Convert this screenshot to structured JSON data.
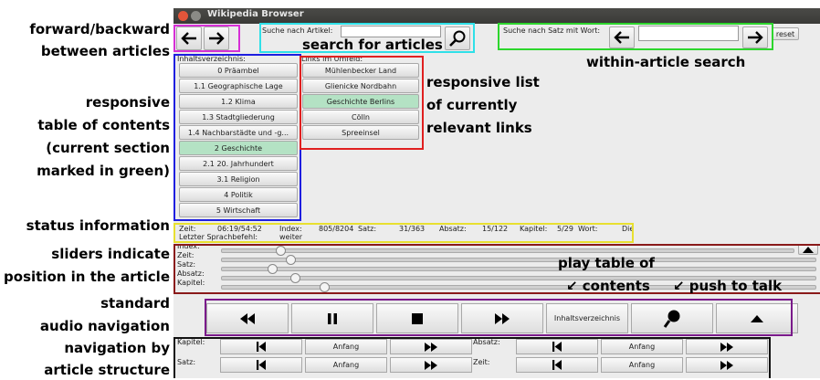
{
  "annotations": {
    "forward_backward": "forward/backward",
    "between_articles": "between articles",
    "search_for_articles": "search for articles",
    "within_article_search": "within-article search",
    "responsive_lines": [
      "responsive",
      "table of contents",
      "(current section",
      "marked in green)"
    ],
    "links_lines": [
      "responsive list",
      "of currently",
      "relevant links"
    ],
    "status_information": "status information",
    "sliders_lines": [
      "sliders indicate",
      "position in the article"
    ],
    "standard_lines": [
      "standard",
      "audio navigation"
    ],
    "structure_lines": [
      "navigation by",
      "article structure"
    ],
    "play_toc_lines": [
      "play table of",
      "↙ contents"
    ],
    "push_to_talk": "↙ push to talk"
  },
  "colors": {
    "pink": "#d62fd6",
    "cyan": "#2fe0e8",
    "green": "#2dd62d",
    "blue": "#1e1ee0",
    "red": "#e02020",
    "yellow": "#e8e030",
    "darkred": "#8a1a1a",
    "purple": "#7a1a8a",
    "black": "#111111",
    "selected_green": "#b4e2c4"
  },
  "window": {
    "title": "Wikipedia Browser"
  },
  "search": {
    "article_label": "Suche nach Artikel:",
    "article_value": "",
    "sentence_label": "Suche nach Satz mit Wort:",
    "sentence_value": "",
    "reset_label": "reset"
  },
  "toc": {
    "header": "Inhaltsverzeichnis:",
    "items": [
      {
        "label": "0 Präambel",
        "selected": false
      },
      {
        "label": "1.1 Geographische Lage",
        "selected": false
      },
      {
        "label": "1.2 Klima",
        "selected": false
      },
      {
        "label": "1.3 Stadtgliederung",
        "selected": false
      },
      {
        "label": "1.4 Nachbarstädte und -g...",
        "selected": false
      },
      {
        "label": "2 Geschichte",
        "selected": true
      },
      {
        "label": "2.1 20. Jahrhundert",
        "selected": false
      },
      {
        "label": "3.1 Religion",
        "selected": false
      },
      {
        "label": "4 Politik",
        "selected": false
      },
      {
        "label": "5 Wirtschaft",
        "selected": false
      }
    ]
  },
  "links": {
    "header": "Links im Umfeld:",
    "items": [
      {
        "label": "Mühlenbecker Land",
        "selected": false
      },
      {
        "label": "Glienicke Nordbahn",
        "selected": false
      },
      {
        "label": "Geschichte Berlins",
        "selected": true
      },
      {
        "label": "Cölln",
        "selected": false
      },
      {
        "label": "Spreeinsel",
        "selected": false
      }
    ]
  },
  "status": {
    "zeit_label": "Zeit:",
    "zeit_value": "06:19/54:52",
    "index_label": "Index:",
    "index_value": "805/8204",
    "satz_label": "Satz:",
    "satz_value": "31/363",
    "absatz_label": "Absatz:",
    "absatz_value": "15/122",
    "kapitel_label": "Kapitel:",
    "kapitel_value": "5/29",
    "wort_label": "Wort:",
    "wort_value": "Die",
    "befehl_label": "Letzter Sprachbefehl:",
    "befehl_value": "weiter"
  },
  "sliders": [
    {
      "label": "Index:",
      "fraction": 0.098
    },
    {
      "label": "Zeit:",
      "fraction": 0.115
    },
    {
      "label": "Satz:",
      "fraction": 0.085
    },
    {
      "label": "Absatz:",
      "fraction": 0.123
    },
    {
      "label": "Kapitel:",
      "fraction": 0.172
    }
  ],
  "audio": {
    "toc_label": "Inhaltsverzeichnis"
  },
  "structure_nav": {
    "kapitel_label": "Kapitel:",
    "satz_label": "Satz:",
    "absatz_label": "Absatz:",
    "zeit_label": "Zeit:",
    "anfang_label": "Anfang"
  }
}
